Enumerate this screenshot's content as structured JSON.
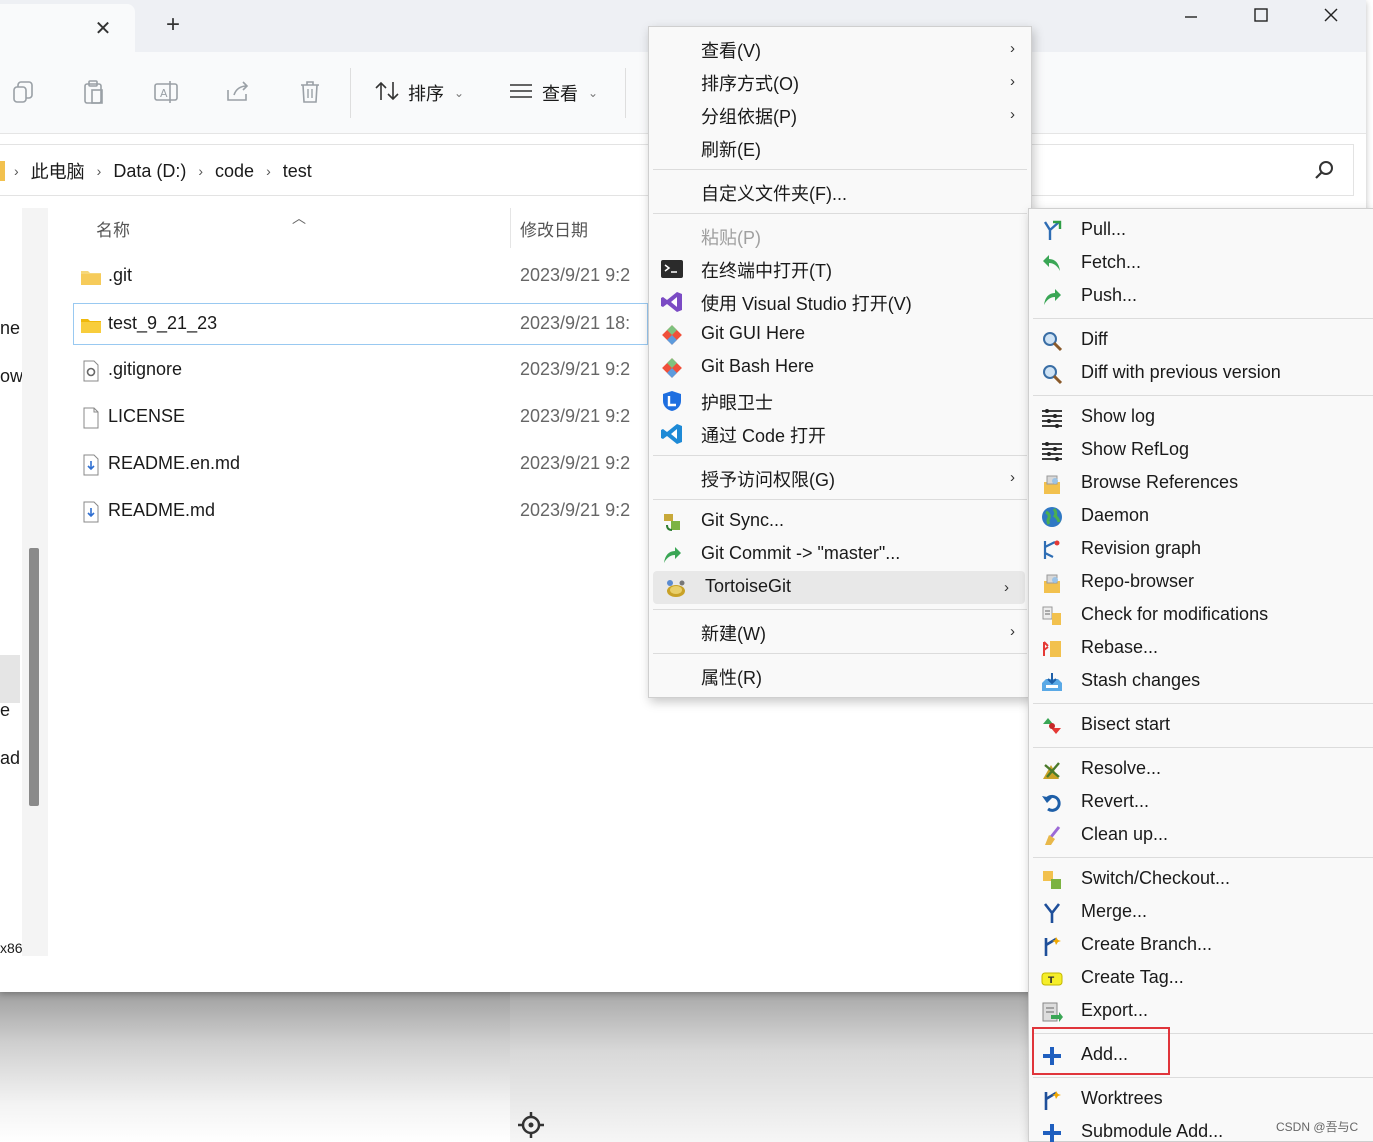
{
  "window": {
    "controls": {
      "minimize": "—",
      "maximize": "☐",
      "close": "✕"
    },
    "tab_close": "✕",
    "tab_add": "+"
  },
  "toolbar": {
    "icons": [
      "copy-icon",
      "paste-icon",
      "rename-icon",
      "share-icon",
      "delete-icon"
    ],
    "sort_label": "排序",
    "view_label": "查看"
  },
  "address": {
    "crumbs": [
      "此电脑",
      "Data (D:)",
      "code",
      "test"
    ]
  },
  "navpane": {
    "fragments": [
      "ne",
      "ow",
      "e",
      "ad",
      "x86"
    ]
  },
  "filelist": {
    "col_name": "名称",
    "col_date": "修改日期",
    "files": [
      {
        "name": ".git",
        "date": "2023/9/21 9:2",
        "type": "folder"
      },
      {
        "name": "test_9_21_23",
        "date": "2023/9/21 18:",
        "type": "folder"
      },
      {
        "name": ".gitignore",
        "date": "2023/9/21 9:2",
        "type": "config"
      },
      {
        "name": "LICENSE",
        "date": "2023/9/21 9:2",
        "type": "file"
      },
      {
        "name": "README.en.md",
        "date": "2023/9/21 9:2",
        "type": "md"
      },
      {
        "name": "README.md",
        "date": "2023/9/21 9:2",
        "type": "md"
      }
    ]
  },
  "context_menu": {
    "items": [
      {
        "label": "查看(V)",
        "submenu": true
      },
      {
        "label": "排序方式(O)",
        "submenu": true
      },
      {
        "label": "分组依据(P)",
        "submenu": true
      },
      {
        "label": "刷新(E)"
      },
      {
        "label": "自定义文件夹(F)..."
      },
      {
        "label": "粘贴(P)",
        "disabled": true
      },
      {
        "label": "在终端中打开(T)",
        "icon": "terminal-icon"
      },
      {
        "label": "使用 Visual Studio 打开(V)",
        "icon": "visual-studio-icon"
      },
      {
        "label": "Git GUI Here",
        "icon": "git-icon"
      },
      {
        "label": "Git Bash Here",
        "icon": "git-icon"
      },
      {
        "label": "护眼卫士",
        "icon": "eye-guard-icon"
      },
      {
        "label": "通过 Code 打开",
        "icon": "vscode-icon"
      },
      {
        "label": "授予访问权限(G)",
        "submenu": true
      },
      {
        "label": "Git Sync...",
        "icon": "git-sync-icon"
      },
      {
        "label": "Git Commit -> \"master\"...",
        "icon": "git-commit-icon"
      },
      {
        "label": "TortoiseGit",
        "icon": "tortoisegit-icon",
        "submenu": true
      },
      {
        "label": "新建(W)",
        "submenu": true
      },
      {
        "label": "属性(R)"
      }
    ]
  },
  "tortoise_menu": {
    "items": [
      {
        "label": "Pull...",
        "icon": "pull-icon"
      },
      {
        "label": "Fetch...",
        "icon": "fetch-icon"
      },
      {
        "label": "Push...",
        "icon": "push-icon"
      },
      {
        "label": "Diff",
        "icon": "diff-icon"
      },
      {
        "label": "Diff with previous version",
        "icon": "diff-icon"
      },
      {
        "label": "Show log",
        "icon": "log-icon"
      },
      {
        "label": "Show RefLog",
        "icon": "log-icon"
      },
      {
        "label": "Browse References",
        "icon": "references-icon"
      },
      {
        "label": "Daemon",
        "icon": "globe-icon"
      },
      {
        "label": "Revision graph",
        "icon": "revision-graph-icon"
      },
      {
        "label": "Repo-browser",
        "icon": "repo-browser-icon"
      },
      {
        "label": "Check for modifications",
        "icon": "check-modifications-icon"
      },
      {
        "label": "Rebase...",
        "icon": "rebase-icon"
      },
      {
        "label": "Stash changes",
        "icon": "stash-icon"
      },
      {
        "label": "Bisect start",
        "icon": "bisect-icon"
      },
      {
        "label": "Resolve...",
        "icon": "resolve-icon"
      },
      {
        "label": "Revert...",
        "icon": "revert-icon"
      },
      {
        "label": "Clean up...",
        "icon": "cleanup-icon"
      },
      {
        "label": "Switch/Checkout...",
        "icon": "switch-icon"
      },
      {
        "label": "Merge...",
        "icon": "merge-icon"
      },
      {
        "label": "Create Branch...",
        "icon": "branch-icon"
      },
      {
        "label": "Create Tag...",
        "icon": "tag-icon"
      },
      {
        "label": "Export...",
        "icon": "export-icon"
      },
      {
        "label": "Add...",
        "icon": "add-icon"
      },
      {
        "label": "Worktrees",
        "icon": "worktree-icon"
      },
      {
        "label": "Submodule Add...",
        "icon": "add-icon"
      }
    ]
  },
  "watermark": "CSDN @吾与C",
  "colors": {
    "accent_blue": "#1a73e8",
    "highlight_red": "#e0353b",
    "folder_yellow": "#f6c344"
  }
}
